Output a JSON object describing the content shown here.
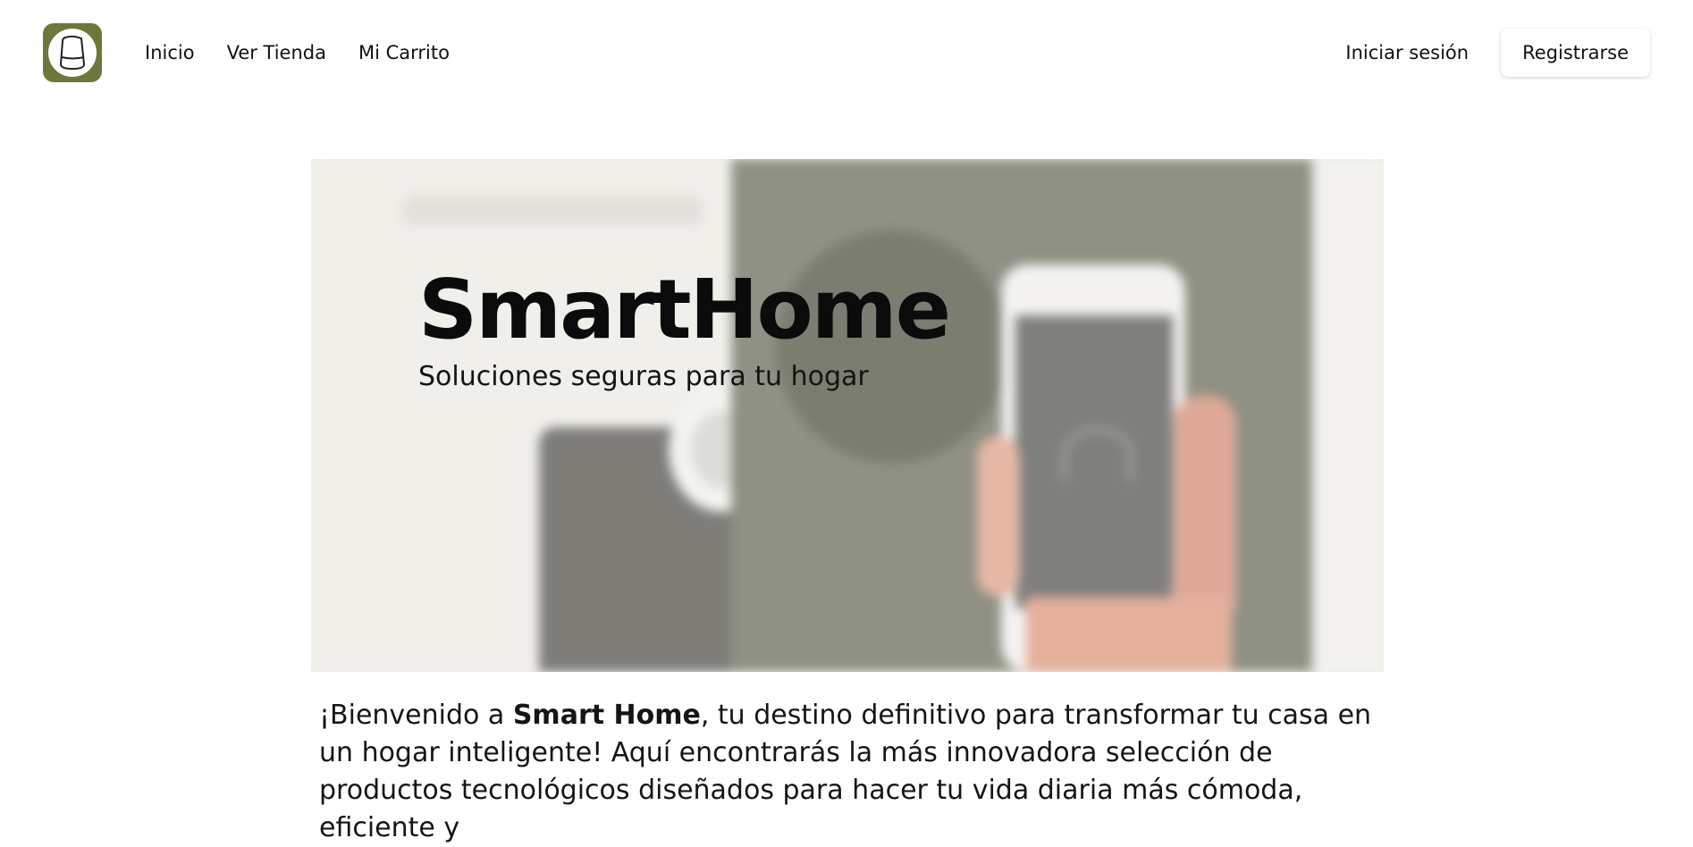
{
  "brand": {
    "logo_icon": "smart-speaker-icon",
    "accent_color": "#6b7839"
  },
  "nav": {
    "items": [
      {
        "label": "Inicio"
      },
      {
        "label": "Ver Tienda"
      },
      {
        "label": "Mi Carrito"
      }
    ]
  },
  "auth": {
    "login_label": "Iniciar sesión",
    "register_label": "Registrarse"
  },
  "hero": {
    "title": "SmartHome",
    "subtitle": "Soluciones seguras para tu hogar",
    "image_subject": "hand holding smartphone with smart lock app, blurred background"
  },
  "intro": {
    "prefix": "¡Bienvenido a ",
    "brand_bold": "Smart Home",
    "text": ", tu destino definitivo para transformar tu casa en un hogar inteligente! Aquí encontrarás la más innovadora selección de productos tecnológicos diseñados para hacer tu vida diaria más cómoda, eficiente y"
  }
}
